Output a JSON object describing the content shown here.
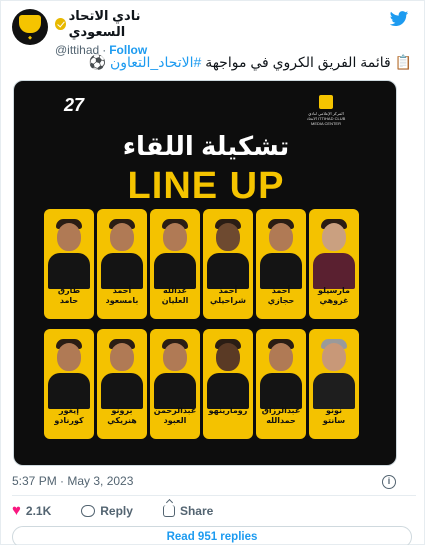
{
  "account": {
    "display_name": "نادي الاتحاد السعودي",
    "handle": "@ittihad",
    "separator": "·",
    "follow_label": "Follow"
  },
  "tweet": {
    "text_prefix": "📋 قائمة الفريق الكروي في مواجهة ",
    "hashtag": "#الاتحاد_التعاون",
    "text_suffix": " ⚽"
  },
  "media": {
    "badge_number": "27",
    "title_ar": "تشكيلة اللقاء",
    "title_en": "LINE UP",
    "media_center_label": "المركز الإعلامي لنادي الاتحاد ITTIHAD CLUB MEDIA CENTER",
    "row1": [
      {
        "name": "طارق\nحامد"
      },
      {
        "name": "أحمد\nبامسعود"
      },
      {
        "name": "عدالله\nالعليان"
      },
      {
        "name": "أحمد\nشراحيلي"
      },
      {
        "name": "أحمد\nحجازي"
      },
      {
        "name": "مارسيلو\nغروهي"
      }
    ],
    "row2": [
      {
        "name": "إيغور\nكورنادو"
      },
      {
        "name": "برونو\nهنريكي"
      },
      {
        "name": "عبدالرحمن\nالعبود"
      },
      {
        "name": "رومارينهو"
      },
      {
        "name": "عبدالرزاق\nحمدالله"
      },
      {
        "name": "نونو\nسانتو"
      }
    ]
  },
  "meta": {
    "timestamp": "5:37 PM · May 3, 2023",
    "info_label": "i"
  },
  "actions": {
    "likes": "2.1K",
    "reply_label": "Reply",
    "share_label": "Share"
  },
  "read_replies": "Read 951 replies",
  "colors": {
    "accent": "#1d9bf0",
    "brand_yellow": "#f5c400",
    "like_pink": "#f91880"
  }
}
